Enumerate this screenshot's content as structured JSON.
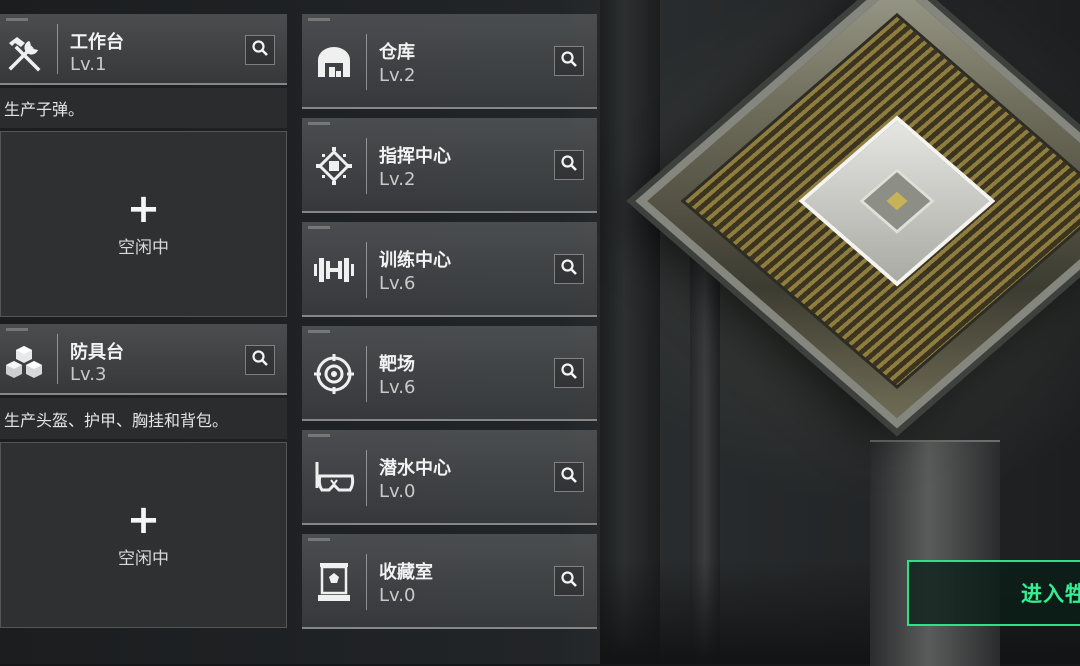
{
  "left_panel": {
    "stations": [
      {
        "name": "工作台",
        "level": "Lv.1",
        "icon": "hammer-wrench-icon",
        "description": "生产子弹。",
        "slot_status": "空闲中"
      },
      {
        "name": "防具台",
        "level": "Lv.3",
        "icon": "boxes-icon",
        "description": "生产头盔、护甲、胸挂和背包。",
        "slot_status": "空闲中"
      }
    ]
  },
  "facility_list": [
    {
      "name": "仓库",
      "level": "Lv.2",
      "icon": "warehouse-icon"
    },
    {
      "name": "指挥中心",
      "level": "Lv.2",
      "icon": "chip-icon"
    },
    {
      "name": "训练中心",
      "level": "Lv.6",
      "icon": "dumbbell-icon"
    },
    {
      "name": "靶场",
      "level": "Lv.6",
      "icon": "target-icon"
    },
    {
      "name": "潜水中心",
      "level": "Lv.0",
      "icon": "diving-mask-icon"
    },
    {
      "name": "收藏室",
      "level": "Lv.0",
      "icon": "display-case-icon"
    }
  ],
  "enter_button": {
    "label": "进入牲"
  },
  "colors": {
    "accent": "#2fe08a",
    "card_bg": "#4e5052",
    "text": "#f2f2f2"
  }
}
